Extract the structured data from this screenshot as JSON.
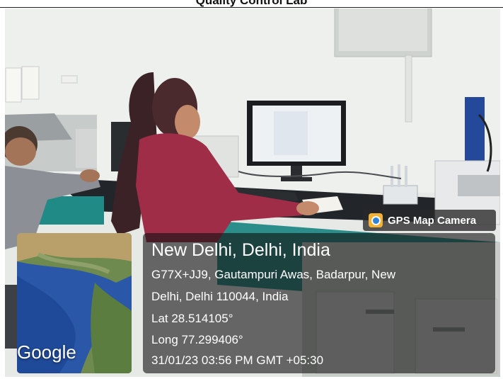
{
  "header": {
    "caption": "Quality Control Lab"
  },
  "overlay": {
    "badge_label": "GPS Map Camera",
    "map_logo": "Google",
    "location_title": "New Delhi, Delhi, India",
    "address_line_1": "G77X+JJ9, Gautampuri Awas, Badarpur, New",
    "address_line_2": "Delhi, Delhi 110044, India",
    "latitude": "Lat 28.514105°",
    "longitude": "Long 77.299406°",
    "timestamp": "31/01/23 03:56 PM GMT +05:30"
  },
  "icons": {
    "badge_icon": "map-pin-icon"
  }
}
